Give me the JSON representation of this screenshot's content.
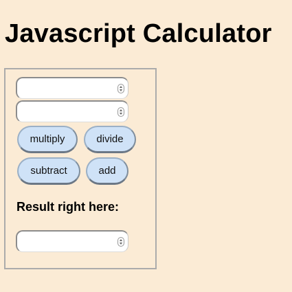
{
  "page": {
    "title": "Javascript Calculator"
  },
  "calculator": {
    "input_a": {
      "value": ""
    },
    "input_b": {
      "value": ""
    },
    "buttons": {
      "multiply": "multiply",
      "divide": "divide",
      "subtract": "subtract",
      "add": "add"
    },
    "result_label": "Result right here:",
    "result": {
      "value": ""
    }
  },
  "icons": {
    "spinner": "stepper-arrows-icon"
  },
  "colors": {
    "background": "#fbebd5",
    "button_fill": "#cfe2f7",
    "box_border": "#ababab"
  }
}
